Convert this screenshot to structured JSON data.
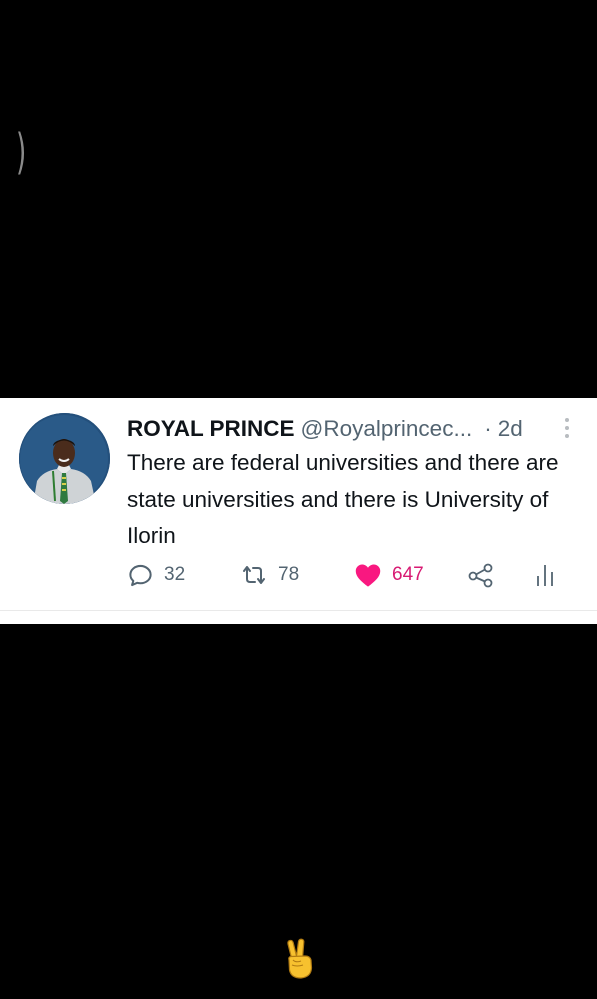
{
  "top_glyph": ")",
  "tweet": {
    "name": "ROYAL PRINCE",
    "handle": "@Royalprincec...",
    "separator": "·",
    "time": "2d",
    "text": "There are federal universities and there are state universities and there is University of Ilorin",
    "actions": {
      "replies": "32",
      "retweets": "78",
      "likes": "647"
    },
    "colors": {
      "like_color": "#f91880",
      "text_color": "#0f1419",
      "muted_color": "#536471"
    },
    "icons": [
      "reply-icon",
      "retweet-icon",
      "like-heart-icon",
      "share-icon",
      "analytics-icon",
      "more-options-icon"
    ]
  },
  "emoji": "victory-hand-emoji"
}
